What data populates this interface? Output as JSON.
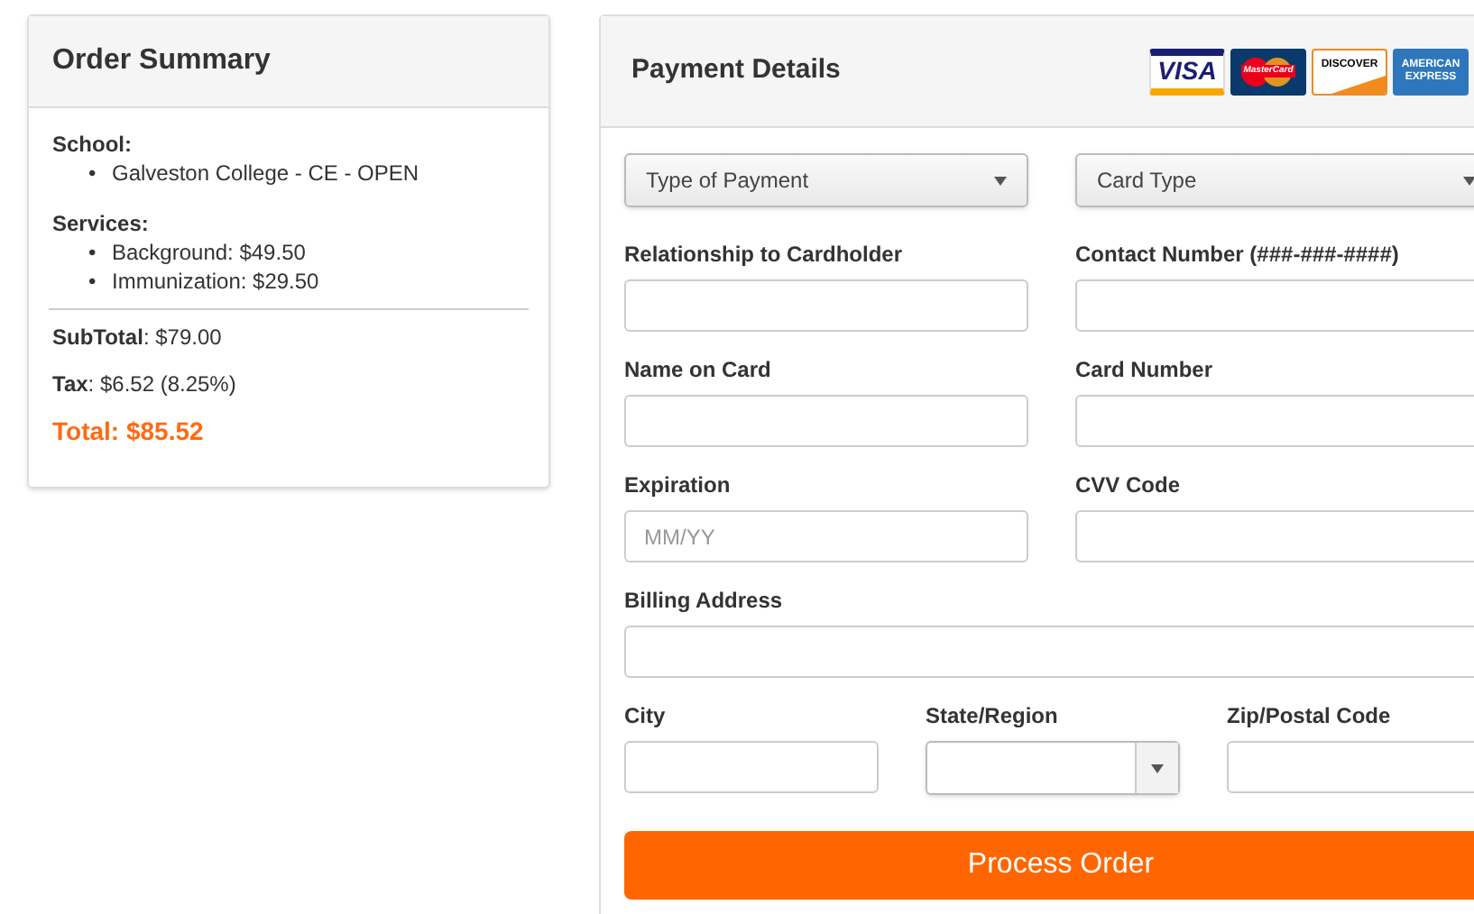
{
  "order_summary": {
    "title": "Order Summary",
    "bullet": "•",
    "school_label": "School:",
    "schools": [
      "Galveston College - CE - OPEN"
    ],
    "services_label": "Services:",
    "services": [
      "Background: $49.50",
      "Immunization: $29.50"
    ],
    "subtotal": {
      "label": "SubTotal",
      "value": ": $79.00"
    },
    "tax": {
      "label": "Tax",
      "value": ": $6.52 (8.25%)"
    },
    "total": {
      "label": "Total",
      "value": ": $85.52"
    }
  },
  "payment": {
    "title": "Payment Details",
    "card_logos": [
      {
        "kind": "visa",
        "text": "VISA"
      },
      {
        "kind": "mastercard",
        "text": "MasterCard"
      },
      {
        "kind": "discover",
        "text": "DISCOVER"
      },
      {
        "kind": "amex",
        "text": "AMERICAN EXPRESS"
      }
    ],
    "selects": [
      {
        "value": "Type of Payment"
      },
      {
        "value": "Card Type"
      }
    ],
    "fields": [
      {
        "label": "Relationship to Cardholder"
      },
      {
        "label": "Contact Number (###-###-####)"
      },
      {
        "label": "Name on Card"
      },
      {
        "label": "Card Number"
      },
      {
        "label": "Expiration",
        "placeholder": "MM/YY"
      },
      {
        "label": "CVV Code"
      }
    ],
    "billing_address": {
      "label": "Billing Address"
    },
    "city": {
      "label": "City"
    },
    "state": {
      "label": "State/Region"
    },
    "zip": {
      "label": "Zip/Postal Code"
    },
    "button": "Process Order"
  }
}
